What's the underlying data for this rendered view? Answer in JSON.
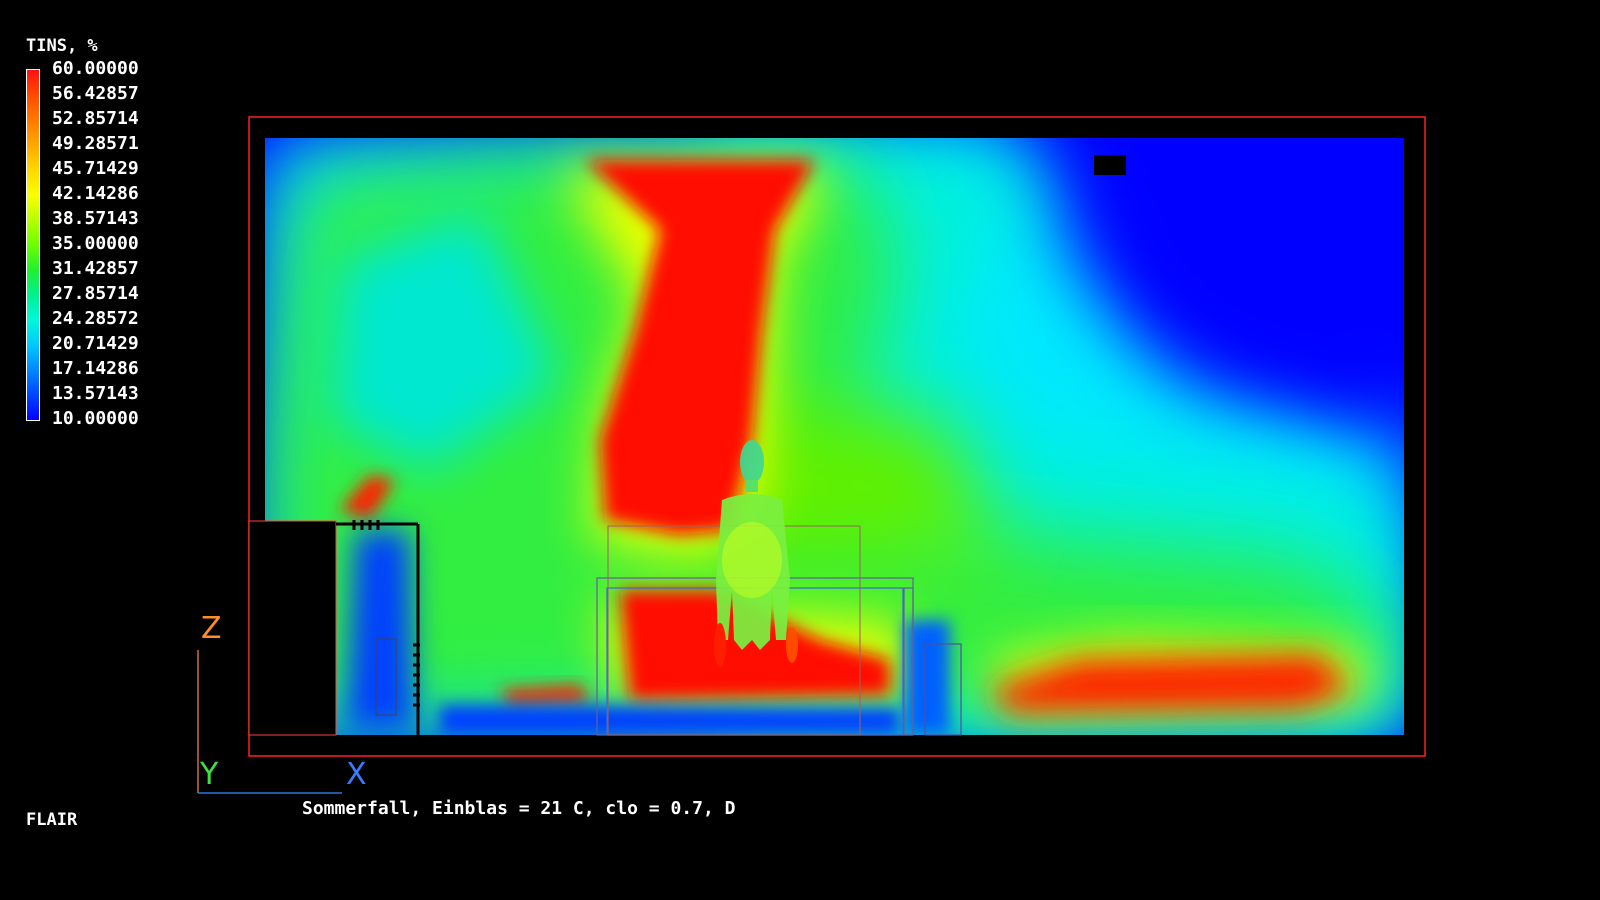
{
  "legend": {
    "title": "TINS, %",
    "values": [
      "60.00000",
      "56.42857",
      "52.85714",
      "49.28571",
      "45.71429",
      "42.14286",
      "38.57143",
      "35.00000",
      "31.42857",
      "27.85714",
      "24.28572",
      "20.71429",
      "17.14286",
      "13.57143",
      "10.00000"
    ],
    "colors": [
      "#ff1010",
      "#ff4a00",
      "#ff7a00",
      "#ffa800",
      "#ffd800",
      "#f8ff00",
      "#b8ff00",
      "#6cff00",
      "#20f030",
      "#00f090",
      "#00f8d8",
      "#00c8ff",
      "#0088ff",
      "#0044ff",
      "#0000ff"
    ]
  },
  "axes": {
    "z": "Z",
    "y": "Y",
    "x": "X"
  },
  "caption": "Sommerfall, Einblas = 21 C, clo = 0.7, D",
  "brand": "FLAIR"
}
